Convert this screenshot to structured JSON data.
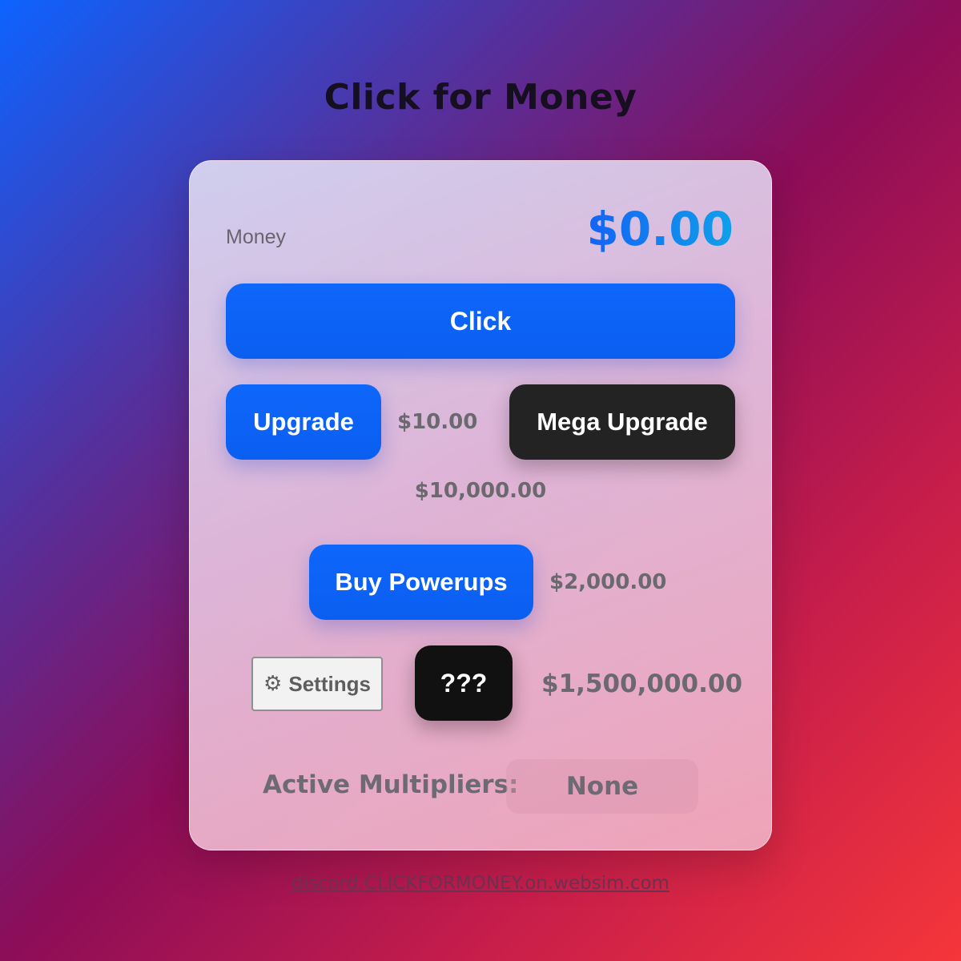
{
  "page": {
    "title": "Click for Money"
  },
  "money": {
    "label": "Money",
    "value": "$0.00"
  },
  "buttons": {
    "click": "Click",
    "upgrade": "Upgrade",
    "mega_upgrade": "Mega Upgrade",
    "buy_powerups": "Buy Powerups",
    "settings": "Settings",
    "mystery": "???"
  },
  "prices": {
    "upgrade": "$10.00",
    "mega_upgrade": "$10,000.00",
    "buy_powerups": "$2,000.00",
    "mystery": "$1,500,000.00"
  },
  "multipliers": {
    "label": "Active Multipliers:",
    "value": "None"
  },
  "footer": {
    "link": "discord.CLICKFORMONEY.on.websim.com"
  },
  "icons": {
    "settings": "gear-icon"
  },
  "colors": {
    "accent_blue": "#0f66fb",
    "dark_button": "#232323",
    "black_button": "#111111",
    "money_gradient_start": "#1463f5",
    "money_gradient_end": "#0fa0ea"
  }
}
